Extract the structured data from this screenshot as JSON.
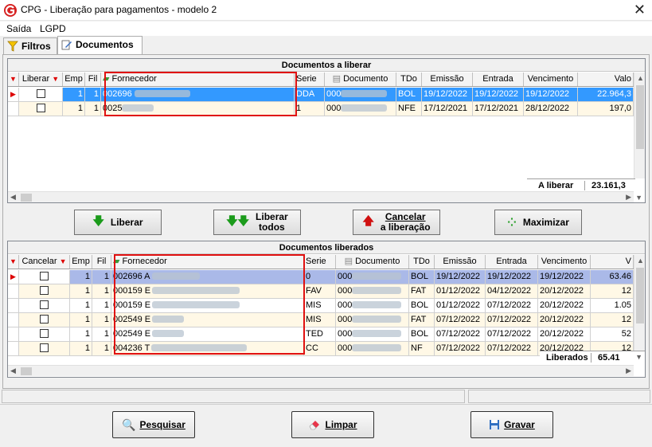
{
  "window": {
    "title": "CPG - Liberação para pagamentos - modelo 2",
    "close": "✕"
  },
  "menu": [
    "Saída",
    "LGPD"
  ],
  "tabs": [
    {
      "label": "Filtros"
    },
    {
      "label": "Documentos"
    }
  ],
  "grid_liberar": {
    "caption": "Documentos a liberar",
    "columns": [
      "Liberar",
      "Emp",
      "Fil",
      "Fornecedor",
      "Serie",
      "Documento",
      "TDo",
      "Emissão",
      "Entrada",
      "Vencimento",
      "Valo"
    ],
    "rows": [
      {
        "emp": "1",
        "fil": "1",
        "fornecedor": "002696",
        "serie": "DDA",
        "documento": "000",
        "tdo": "BOL",
        "emissao": "19/12/2022",
        "entrada": "19/12/2022",
        "vencimento": "19/12/2022",
        "valor": "22.964,3"
      },
      {
        "emp": "1",
        "fil": "1",
        "fornecedor": "0025",
        "serie": "1",
        "documento": "000",
        "tdo": "NFE",
        "emissao": "17/12/2021",
        "entrada": "17/12/2021",
        "vencimento": "28/12/2022",
        "valor": "197,0"
      }
    ],
    "total_label": "A liberar",
    "total_value": "23.161,3"
  },
  "actions": {
    "liberar": "Liberar",
    "liberar_todos_1": "Liberar",
    "liberar_todos_2": "todos",
    "cancelar_1": "Cancelar",
    "cancelar_2": "a liberação",
    "maximizar": "Maximizar"
  },
  "grid_liberados": {
    "caption": "Documentos liberados",
    "columns": [
      "Cancelar",
      "Emp",
      "Fil",
      "Fornecedor",
      "Serie",
      "Documento",
      "TDo",
      "Emissão",
      "Entrada",
      "Vencimento",
      "V"
    ],
    "rows": [
      {
        "emp": "1",
        "fil": "1",
        "fornecedor": "002696 A",
        "serie": "0",
        "documento": "000",
        "tdo": "BOL",
        "emissao": "19/12/2022",
        "entrada": "19/12/2022",
        "vencimento": "19/12/2022",
        "valor": "63.46"
      },
      {
        "emp": "1",
        "fil": "1",
        "fornecedor": "000159 E",
        "serie": "FAV",
        "documento": "000",
        "tdo": "FAT",
        "emissao": "01/12/2022",
        "entrada": "04/12/2022",
        "vencimento": "20/12/2022",
        "valor": "12"
      },
      {
        "emp": "1",
        "fil": "1",
        "fornecedor": "000159 E",
        "serie": "MIS",
        "documento": "000",
        "tdo": "BOL",
        "emissao": "01/12/2022",
        "entrada": "07/12/2022",
        "vencimento": "20/12/2022",
        "valor": "1.05"
      },
      {
        "emp": "1",
        "fil": "1",
        "fornecedor": "002549 E",
        "serie": "MIS",
        "documento": "000",
        "tdo": "FAT",
        "emissao": "07/12/2022",
        "entrada": "07/12/2022",
        "vencimento": "20/12/2022",
        "valor": "12"
      },
      {
        "emp": "1",
        "fil": "1",
        "fornecedor": "002549 E",
        "serie": "TED",
        "documento": "000",
        "tdo": "BOL",
        "emissao": "07/12/2022",
        "entrada": "07/12/2022",
        "vencimento": "20/12/2022",
        "valor": "52"
      },
      {
        "emp": "1",
        "fil": "1",
        "fornecedor": "004236 T",
        "serie": "CC",
        "documento": "000",
        "tdo": "NF",
        "emissao": "07/12/2022",
        "entrada": "07/12/2022",
        "vencimento": "20/12/2022",
        "valor": "12"
      }
    ],
    "total_label": "Liberados",
    "total_value": "65.41"
  },
  "footer": {
    "pesquisar": "Pesquisar",
    "limpar": "Limpar",
    "gravar": "Gravar"
  },
  "colors": {
    "selection": "#3399ff",
    "highlight_box": "#e01010",
    "selected_lavender": "#aab9e8"
  }
}
